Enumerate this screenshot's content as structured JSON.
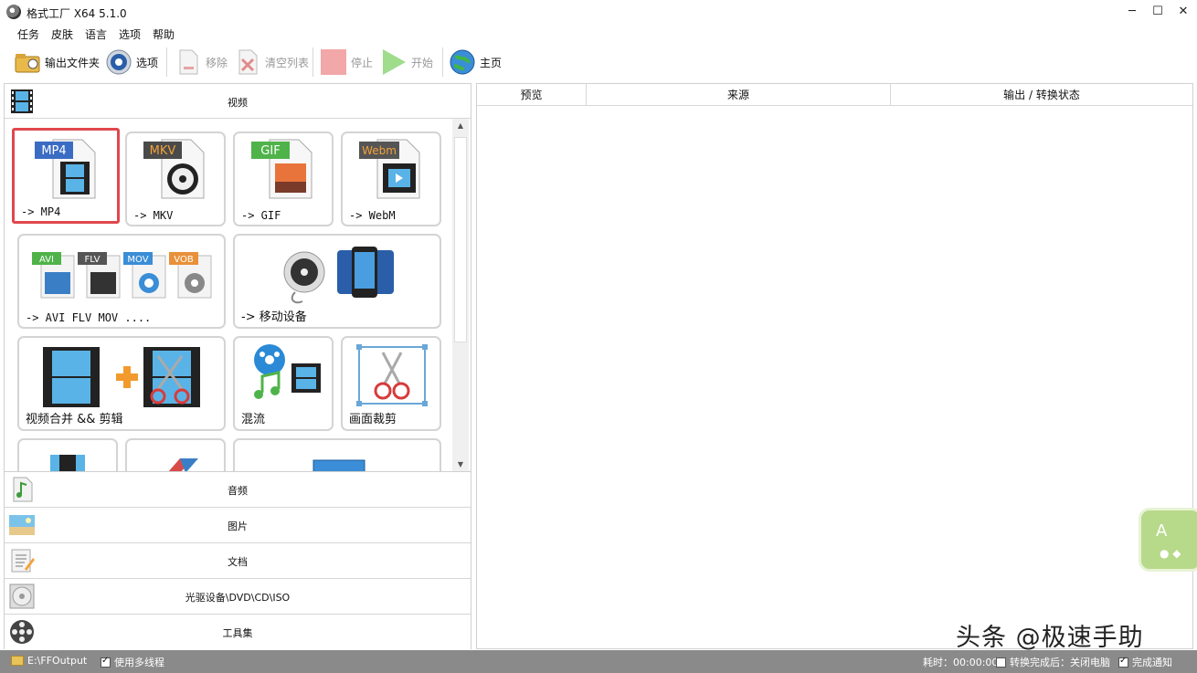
{
  "window": {
    "title": "格式工厂 X64 5.1.0",
    "minimize": "─",
    "maximize": "☐",
    "close": "✕"
  },
  "menu": [
    "任务",
    "皮肤",
    "语言",
    "选项",
    "帮助"
  ],
  "toolbar": {
    "output_folder": "输出文件夹",
    "options": "选项",
    "remove": "移除",
    "clear_list": "清空列表",
    "stop": "停止",
    "start": "开始",
    "home": "主页"
  },
  "categories": {
    "video": "视频",
    "audio": "音频",
    "picture": "图片",
    "document": "文档",
    "rom": "光驱设备\\DVD\\CD\\ISO",
    "tools": "工具集"
  },
  "tiles": {
    "mp4": {
      "badge": "MP4",
      "label": "-> MP4"
    },
    "mkv": {
      "badge": "MKV",
      "label": "-> MKV"
    },
    "gif": {
      "badge": "GIF",
      "label": "-> GIF"
    },
    "webm": {
      "badge": "Webm",
      "label": "-> WebM"
    },
    "multi": {
      "badges": [
        "AVI",
        "FLV",
        "MOV",
        "VOB"
      ],
      "label": "-> AVI FLV MOV ...."
    },
    "mobile": {
      "label": "-> 移动设备"
    },
    "merge": {
      "label": "视频合并 && 剪辑"
    },
    "mux": {
      "label": "混流"
    },
    "crop": {
      "label": "画面裁剪"
    }
  },
  "table": {
    "columns": [
      "预览",
      "来源",
      "输出 / 转换状态"
    ]
  },
  "status": {
    "output_path": "E:\\FFOutput",
    "multithread": "使用多线程",
    "elapsed": "耗时：00:00:00",
    "after_done": "转换完成后：关闭电脑",
    "notify": "完成通知"
  },
  "widget": {
    "letter": "A"
  },
  "watermark": "头条 @极速手助"
}
